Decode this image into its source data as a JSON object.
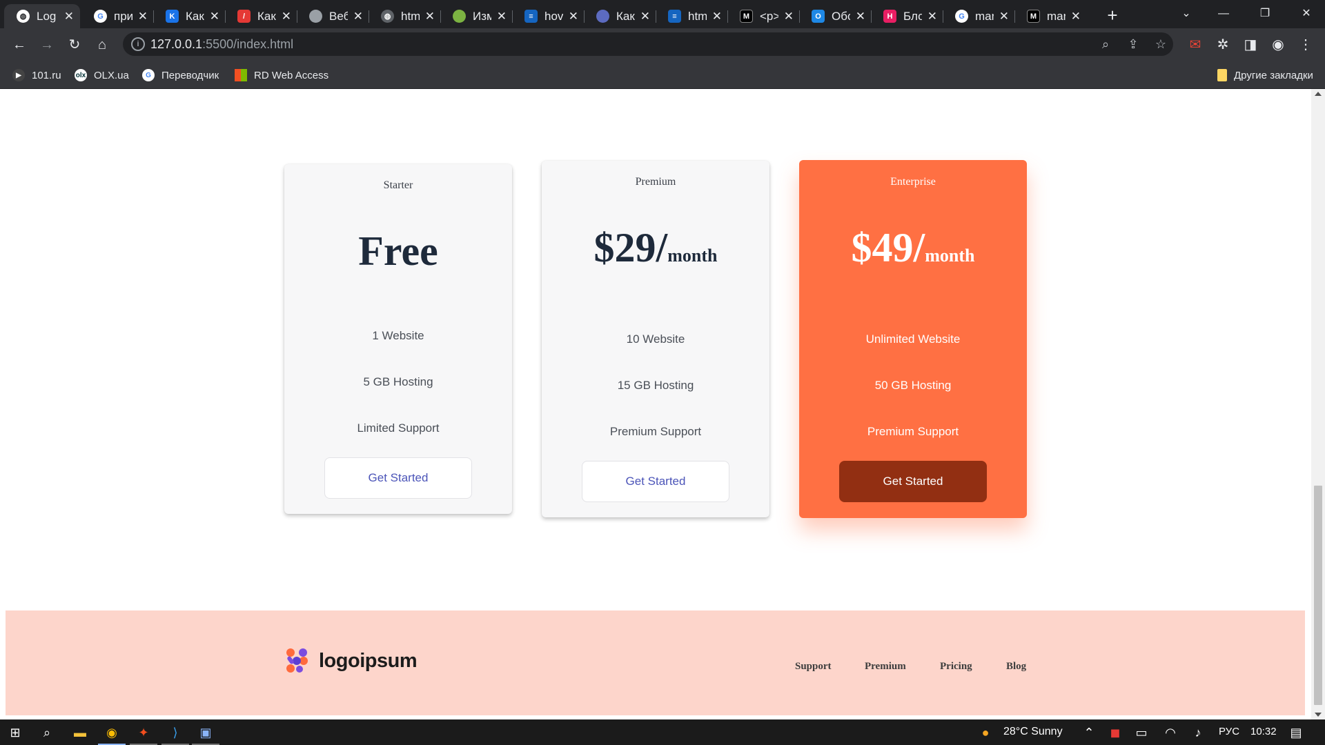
{
  "browser": {
    "tabs": [
      {
        "label": "Log",
        "icon": "globe-icon",
        "color": "#ffffff",
        "active": true
      },
      {
        "label": "при",
        "icon": "google-icon",
        "color": "#4285f4"
      },
      {
        "label": "Как",
        "icon": "site-icon",
        "color": "#1a73e8"
      },
      {
        "label": "Как",
        "icon": "site-icon",
        "color": "#e53935"
      },
      {
        "label": "Веб",
        "icon": "site-icon",
        "color": "#9aa0a6"
      },
      {
        "label": "htm",
        "icon": "globe-icon",
        "color": "#9aa0a6"
      },
      {
        "label": "Изм",
        "icon": "site-icon",
        "color": "#7cb342"
      },
      {
        "label": "hov",
        "icon": "stackoverflow-icon",
        "color": "#1565c0"
      },
      {
        "label": "Как",
        "icon": "site-icon",
        "color": "#5c6bc0"
      },
      {
        "label": "htm",
        "icon": "stackoverflow-icon",
        "color": "#1565c0"
      },
      {
        "label": "<p>",
        "icon": "medium-icon",
        "color": "#000000"
      },
      {
        "label": "Обо",
        "icon": "site-icon",
        "color": "#1e88e5"
      },
      {
        "label": "Бло",
        "icon": "site-icon",
        "color": "#e91e63"
      },
      {
        "label": "mar",
        "icon": "google-icon",
        "color": "#4285f4"
      },
      {
        "label": "mar",
        "icon": "medium-icon",
        "color": "#000000"
      }
    ],
    "url_host": "127.0.0.1",
    "url_rest": ":5500/index.html",
    "bookmarks": [
      {
        "label": "101.ru",
        "icon": "play-icon",
        "color": "#444444"
      },
      {
        "label": "OLX.ua",
        "icon": "olx-icon",
        "color": "#ffffff"
      },
      {
        "label": "Переводчик",
        "icon": "google-icon",
        "color": "#4285f4"
      },
      {
        "label": "RD Web Access",
        "icon": "windows-icon",
        "color": "#f25022"
      }
    ],
    "other_bookmarks": "Другие закладки"
  },
  "pricing": {
    "plans": [
      {
        "name": "Starter",
        "price": "Free",
        "unit": "",
        "features": [
          "1 Website",
          "5 GB Hosting",
          "Limited Support"
        ],
        "cta": "Get Started",
        "highlight": false
      },
      {
        "name": "Premium",
        "price": "$29/",
        "unit": "month",
        "features": [
          "10 Website",
          "15 GB Hosting",
          "Premium Support"
        ],
        "cta": "Get Started",
        "highlight": false
      },
      {
        "name": "Enterprise",
        "price": "$49/",
        "unit": "month",
        "features": [
          "Unlimited Website",
          "50 GB Hosting",
          "Premium Support"
        ],
        "cta": "Get Started",
        "highlight": true
      }
    ]
  },
  "footer": {
    "logo_text": "logoipsum",
    "links": [
      "Support",
      "Premium",
      "Pricing",
      "Blog"
    ]
  },
  "taskbar": {
    "weather": "28°C  Sunny",
    "language": "РУС",
    "time": "10:32"
  },
  "colors": {
    "accent": "#ff7043",
    "accent_button": "#922f12",
    "footer_bg": "#fdd5cb",
    "link_blue": "#4b54b8"
  }
}
